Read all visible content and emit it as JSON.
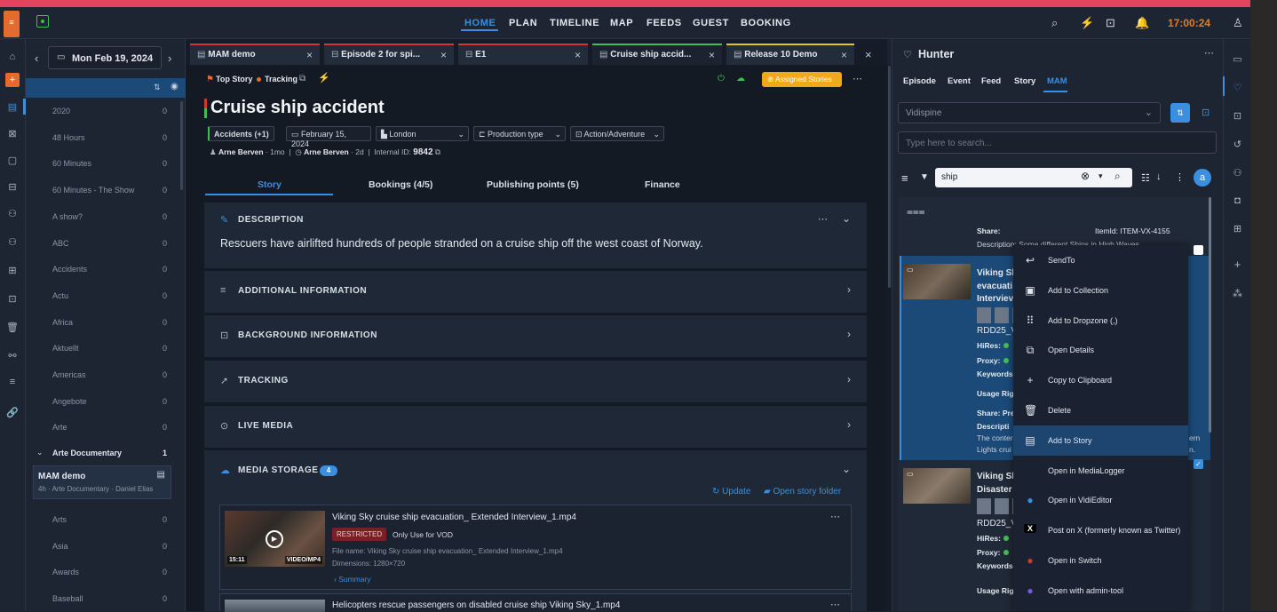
{
  "topbar": {
    "nav": [
      "HOME",
      "PLAN",
      "TIMELINE",
      "MAP",
      "FEEDS",
      "GUEST",
      "BOOKING"
    ],
    "clock": "17:00:24"
  },
  "sidebar": {
    "date": "Mon Feb 19, 2024",
    "items": [
      {
        "label": "2020",
        "count": "0"
      },
      {
        "label": "48 Hours",
        "count": "0"
      },
      {
        "label": "60 Minutes",
        "count": "0"
      },
      {
        "label": "60 Minutes - The Show",
        "count": "0"
      },
      {
        "label": "A show?",
        "count": "0"
      },
      {
        "label": "ABC",
        "count": "0"
      },
      {
        "label": "Accidents",
        "count": "0"
      },
      {
        "label": "Actu",
        "count": "0"
      },
      {
        "label": "Africa",
        "count": "0"
      },
      {
        "label": "Aktuellt",
        "count": "0"
      },
      {
        "label": "Americas",
        "count": "0"
      },
      {
        "label": "Angebote",
        "count": "0"
      },
      {
        "label": "Arte",
        "count": "0"
      }
    ],
    "group": {
      "label": "Arte Documentary",
      "count": "1"
    },
    "story_card": {
      "title": "MAM demo",
      "sub": "4h · Arte Documentary · Daniel Elias"
    },
    "items2": [
      {
        "label": "Arts",
        "count": "0"
      },
      {
        "label": "Asia",
        "count": "0"
      },
      {
        "label": "Awards",
        "count": "0"
      },
      {
        "label": "Baseball",
        "count": "0"
      }
    ]
  },
  "tabs": [
    {
      "label": "MAM demo",
      "color": "#d0392b"
    },
    {
      "label": "Episode 2 for spi...",
      "color": "#d0392b"
    },
    {
      "label": "E1",
      "color": "#d0392b"
    },
    {
      "label": "Cruise ship accid...",
      "color": "#3fbf4f"
    },
    {
      "label": "Release 10 Demo",
      "color": "#e6c229"
    }
  ],
  "story": {
    "top_story": "Top Story",
    "tracking": "Tracking",
    "assigned": "Assigned Stories",
    "title": "Cruise ship accident",
    "category": "Accidents (+1)",
    "date": "February 15, 2024",
    "location": "London",
    "production_type": "Production type",
    "genre": "Action/Adventure",
    "author1": "Arne Berven",
    "age1": "1mo",
    "author2": "Arne Berven",
    "age2": "2d",
    "internal_id_label": "Internal ID:",
    "internal_id": "9842",
    "tabs": [
      "Story",
      "Bookings (4/5)",
      "Publishing points (5)",
      "Finance"
    ],
    "description_label": "DESCRIPTION",
    "description": "Rescuers have airlifted hundreds of people stranded on a cruise ship off the west coast of Norway.",
    "sections": [
      "ADDITIONAL INFORMATION",
      "BACKGROUND INFORMATION",
      "TRACKING",
      "LIVE MEDIA"
    ],
    "media_label": "MEDIA STORAGE",
    "media_count": "4",
    "update": "Update",
    "open_folder": "Open story folder",
    "media": [
      {
        "title": "Viking Sky cruise ship evacuation_ Extended Interview_1.mp4",
        "badge": "RESTRICTED",
        "note": "Only Use for VOD",
        "file": "File name: Viking Sky cruise ship evacuation_ Extended Interview_1.mp4",
        "dims": "Dimensions: 1280×720",
        "summary": "Summary",
        "duration": "15:11",
        "format": "VIDEO/MP4"
      },
      {
        "title": "Helicopters rescue passengers on disabled cruise ship Viking Sky_1.mp4"
      }
    ]
  },
  "hunter": {
    "title": "Hunter",
    "tabs": [
      "Episode",
      "Event",
      "Feed",
      "Story",
      "MAM"
    ],
    "source": "Vidispine",
    "search_placeholder": "Type here to search...",
    "query": "ship",
    "avatar": "a",
    "card": {
      "share": "Share:",
      "itemid": "ItemId: ITEM-VX-4155",
      "desc": "Description: Some different Ships in High Waves"
    },
    "results": [
      {
        "title": "Viking Sl",
        "line2": "evacuati",
        "line3": "Interviev",
        "rdd": "RDD25_V",
        "hires": "HiRes:",
        "proxy": "Proxy:",
        "keywords": "Keywords",
        "usage": "Usage Rig",
        "share": "Share: Pre",
        "desc": "Descripti",
        "desc2": "The conter",
        "desc3": "Lights crui",
        "tail1": "ern",
        "tail2": "n."
      },
      {
        "title": "Viking Sl",
        "line2": "Disaster",
        "rdd": "RDD25_V",
        "hires": "HiRes:",
        "proxy": "Proxy:",
        "keywords": "Keywords",
        "usage": "Usage Rig"
      }
    ],
    "menu": [
      {
        "label": "SendTo",
        "icon": "↩"
      },
      {
        "label": "Add to Collection",
        "icon": "▣"
      },
      {
        "label": "Add to Dropzone (,)",
        "icon": "⠿"
      },
      {
        "label": "Open Details",
        "icon": "⧉"
      },
      {
        "label": "Copy to Clipboard",
        "icon": "+"
      },
      {
        "label": "Delete",
        "icon": "🗑"
      },
      {
        "label": "Add to Story",
        "icon": "▤"
      },
      {
        "label": "Open in MediaLogger",
        "icon": ""
      },
      {
        "label": "Open in VidiEditor",
        "icon": "●"
      },
      {
        "label": "Post on X (formerly known as Twitter)",
        "icon": "X"
      },
      {
        "label": "Open in Switch",
        "icon": "●"
      },
      {
        "label": "Open with admin-tool",
        "icon": "●"
      }
    ],
    "menu_active": 6
  },
  "colors": {
    "accent": "#3a8fe0",
    "brand": "#e2435f",
    "assigned": "#f0a91b",
    "restricted": "#7a1f24"
  }
}
